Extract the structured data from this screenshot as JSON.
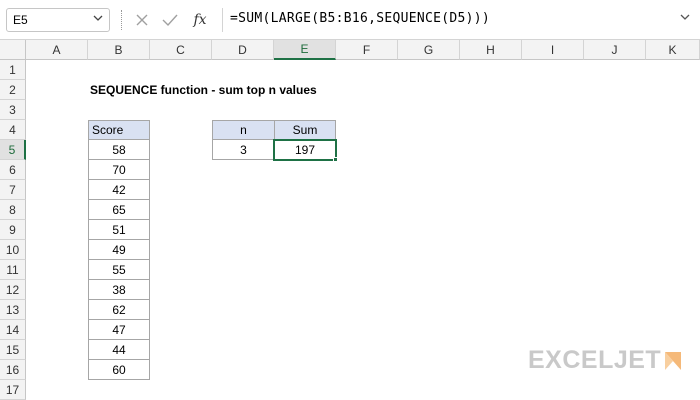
{
  "formula_bar": {
    "name_box": "E5",
    "formula": "=SUM(LARGE(B5:B16,SEQUENCE(D5)))",
    "icons": [
      "more-options-icon",
      "cancel-icon",
      "enter-icon",
      "insert-function-icon",
      "expand-formula-bar-icon"
    ]
  },
  "columns": [
    "A",
    "B",
    "C",
    "D",
    "E",
    "F",
    "G",
    "H",
    "I",
    "J",
    "K"
  ],
  "rows": [
    "1",
    "2",
    "3",
    "4",
    "5",
    "6",
    "7",
    "8",
    "9",
    "10",
    "11",
    "12",
    "13",
    "14",
    "15",
    "16",
    "17"
  ],
  "active_cell": {
    "column": "E",
    "row": "5"
  },
  "sheet": {
    "title": "SEQUENCE function - sum top n values",
    "score_header": "Score",
    "scores": [
      "58",
      "70",
      "42",
      "65",
      "51",
      "49",
      "55",
      "38",
      "62",
      "47",
      "44",
      "60"
    ],
    "n_header": "n",
    "sum_header": "Sum",
    "n_value": "3",
    "sum_value": "197"
  },
  "colors": {
    "header_fill": "#d9e1f2",
    "active_border": "#1e7145",
    "watermark": "#c9c9c9",
    "logo_accent": "#f5b979"
  },
  "watermark": {
    "text": "EXCELJET"
  }
}
